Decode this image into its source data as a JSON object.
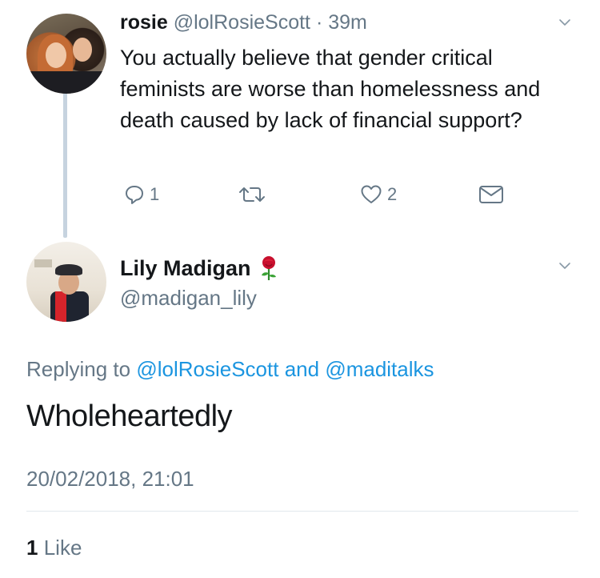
{
  "parent_tweet": {
    "display_name": "rosie",
    "handle": "@lolRosieScott",
    "separator": "·",
    "time": "39m",
    "text": "You actually believe that gender critical feminists are worse than homelessness and death caused by lack of financial support?",
    "actions": {
      "reply_count": "1",
      "retweet_count": "",
      "like_count": "2"
    }
  },
  "main_tweet": {
    "display_name": "Lily Madigan",
    "handle": "@madigan_lily",
    "replying_prefix": "Replying to",
    "replying_to_1": "@lolRosieScott",
    "replying_and": "and",
    "replying_to_2": "@maditalks",
    "text": "Wholeheartedly",
    "timestamp": "20/02/2018, 21:01",
    "likes_count": "1",
    "likes_label": "Like"
  },
  "icons": [
    "chevron-down-icon",
    "reply-icon",
    "retweet-icon",
    "heart-icon",
    "dm-envelope-icon",
    "rose-emoji-icon"
  ],
  "colors": {
    "text": "#14171a",
    "secondary": "#657786",
    "link": "#1b95e0",
    "thread_line": "#c6d3df",
    "divider": "#e1e8ed"
  }
}
